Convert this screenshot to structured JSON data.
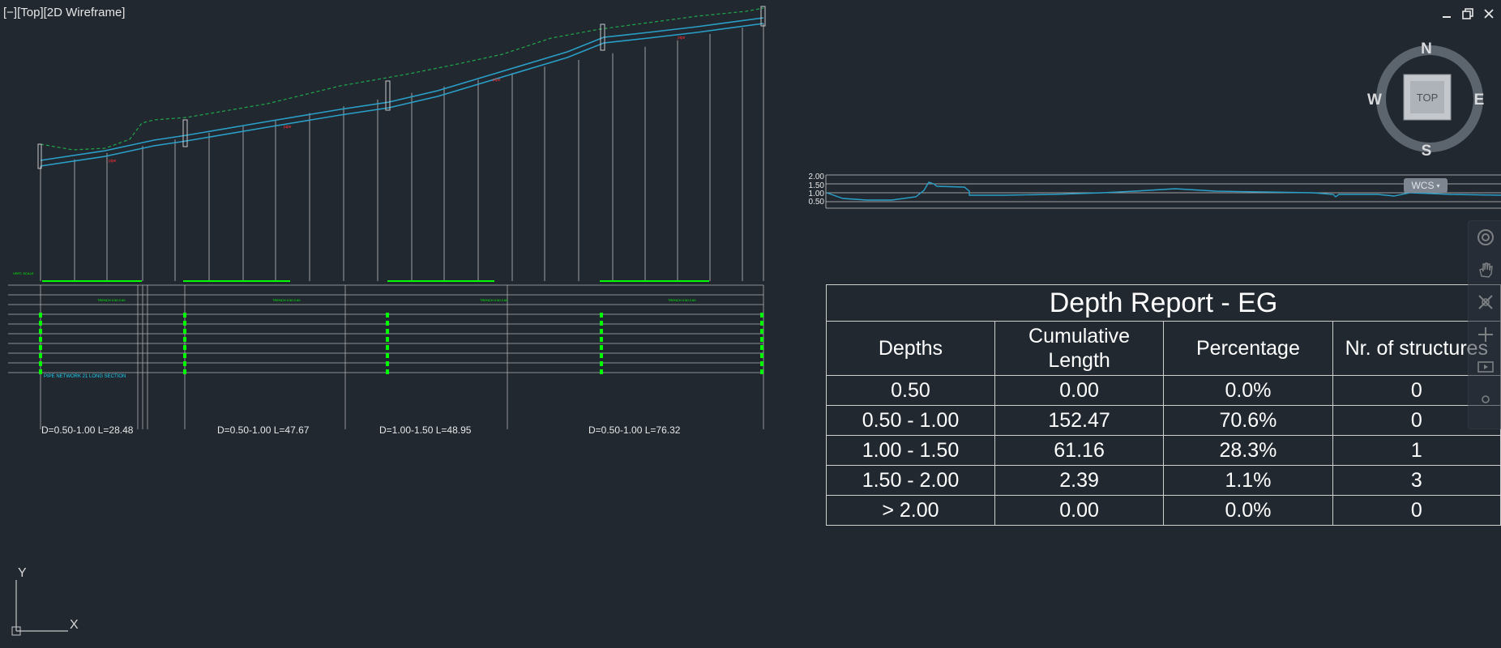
{
  "viewport": {
    "label": "[−][Top][2D Wireframe]"
  },
  "window_controls": [
    "minimize-icon",
    "restore-icon",
    "close-icon"
  ],
  "colors": {
    "background": "#212830",
    "pipe": "#2aa0c8",
    "ground": "#1fa84a",
    "band": "#00ff00",
    "grid": "#c8c8c8"
  },
  "profile": {
    "section_labels": [
      "D=0.50-1.00 L=28.48",
      "D=0.50-1.00 L=47.67",
      "D=1.00-1.50 L=48.95",
      "D=0.50-1.00 L=76.32"
    ],
    "band_caption": "PIPE NETWORK 21 LONG SECTION"
  },
  "depth_chart": {
    "y_ticks": [
      "2.00",
      "1.50",
      "1.00",
      "0.50"
    ]
  },
  "compass": {
    "n": "N",
    "s": "S",
    "e": "E",
    "w": "W",
    "center": "TOP"
  },
  "wcs_label": "WCS",
  "ucs": {
    "y": "Y",
    "x": "X"
  },
  "report": {
    "title": "Depth Report - EG",
    "headers": [
      "Depths",
      "Cumulative Length",
      "Percentage",
      "Nr. of structures"
    ],
    "rows": [
      [
        "0.50",
        "0.00",
        "0.0%",
        "0"
      ],
      [
        "0.50 - 1.00",
        "152.47",
        "70.6%",
        "0"
      ],
      [
        "1.00 - 1.50",
        "61.16",
        "28.3%",
        "1"
      ],
      [
        "1.50 - 2.00",
        "2.39",
        "1.1%",
        "3"
      ],
      [
        "> 2.00",
        "0.00",
        "0.0%",
        "0"
      ]
    ]
  }
}
